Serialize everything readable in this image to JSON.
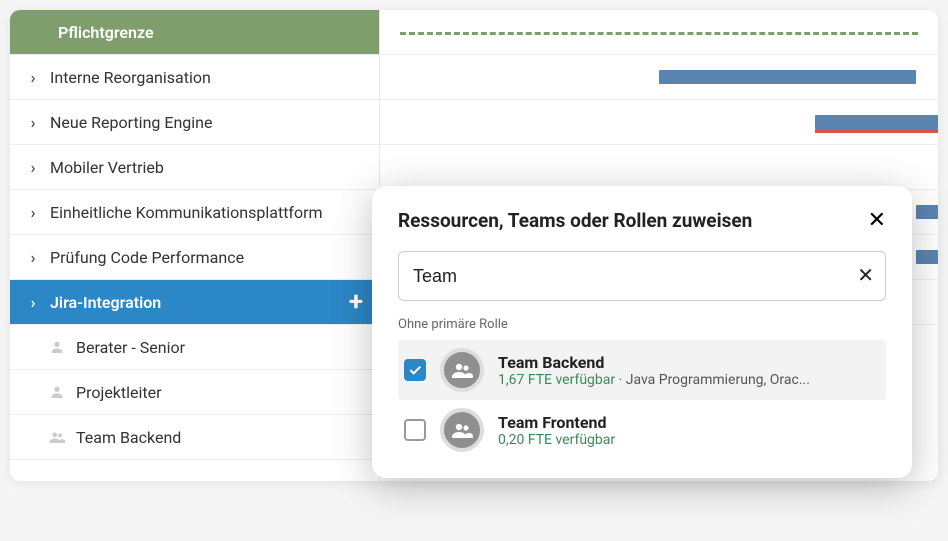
{
  "sidebar": {
    "header": "Pflichtgrenze",
    "items": [
      {
        "label": "Interne Reorganisation"
      },
      {
        "label": "Neue Reporting Engine"
      },
      {
        "label": "Mobiler Vertrieb"
      },
      {
        "label": "Einheitliche Kommunikationsplattform"
      },
      {
        "label": "Prüfung Code Performance"
      },
      {
        "label": "Jira-Integration",
        "selected": true
      }
    ],
    "sub": [
      {
        "label": "Berater - Senior",
        "icon": "person"
      },
      {
        "label": "Projektleiter",
        "icon": "person"
      },
      {
        "label": "Team Backend",
        "icon": "team"
      }
    ]
  },
  "gantt": {
    "bars": [
      {
        "row": 1,
        "left_pct": 50,
        "width_pct": 46
      },
      {
        "row": 2,
        "left_pct": 78,
        "width_pct": 22,
        "red": true
      },
      {
        "row": 4,
        "left_pct": 96,
        "width_pct": 4
      },
      {
        "row": 5,
        "left_pct": 96,
        "width_pct": 4
      }
    ]
  },
  "modal": {
    "title": "Ressourcen, Teams oder Rollen zuweisen",
    "search_value": "Team",
    "section_label": "Ohne primäre Rolle",
    "results": [
      {
        "name": "Team Backend",
        "fte": "1,67 FTE verfügbar",
        "extra": "  · Java Programmierung, Orac...",
        "checked": true
      },
      {
        "name": "Team Frontend",
        "fte": "0,20 FTE verfügbar",
        "extra": "",
        "checked": false
      }
    ]
  }
}
